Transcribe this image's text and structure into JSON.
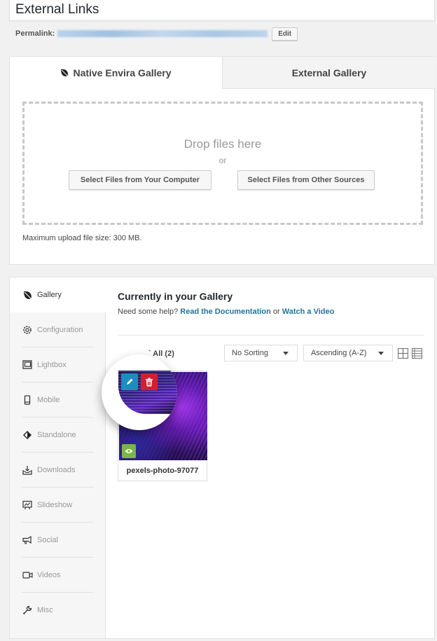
{
  "post": {
    "title": "External Links",
    "permalink_label": "Permalink:",
    "permalink_url": "",
    "edit_label": "Edit"
  },
  "upload": {
    "tabs": [
      {
        "label": "Native Envira Gallery",
        "icon": "leaf-icon",
        "active": true
      },
      {
        "label": "External Gallery",
        "active": false
      }
    ],
    "drop_title": "Drop files here",
    "drop_or": "or",
    "select_computer_label": "Select Files from Your Computer",
    "select_other_label": "Select Files from Other Sources",
    "max_size": "Maximum upload file size: 300 MB."
  },
  "sidebar": {
    "items": [
      {
        "label": "Gallery",
        "icon": "leaf-icon",
        "active": true
      },
      {
        "label": "Configuration",
        "icon": "gear-icon"
      },
      {
        "label": "Lightbox",
        "icon": "lightbox-icon"
      },
      {
        "label": "Mobile",
        "icon": "mobile-icon"
      },
      {
        "label": "Standalone",
        "icon": "standalone-icon"
      },
      {
        "label": "Downloads",
        "icon": "download-icon"
      },
      {
        "label": "Slideshow",
        "icon": "slideshow-icon"
      },
      {
        "label": "Social",
        "icon": "megaphone-icon"
      },
      {
        "label": "Videos",
        "icon": "video-camera-icon"
      },
      {
        "label": "Misc",
        "icon": "wrench-icon"
      }
    ]
  },
  "gallery": {
    "heading": "Currently in your Gallery",
    "help_prefix": "Need some help?",
    "help_doc_link": "Read the Documentation",
    "help_or": "or",
    "help_video_link": "Watch a Video",
    "select_all": "` All (2)",
    "sort_value": "No Sorting",
    "order_value": "Ascending (A-Z)",
    "items": [
      {
        "name": "pexels-photo-97077"
      }
    ],
    "colors": {
      "edit": "#1e8cbe",
      "delete": "#d0202f",
      "preview": "#7ab648",
      "link": "#21759b"
    }
  }
}
